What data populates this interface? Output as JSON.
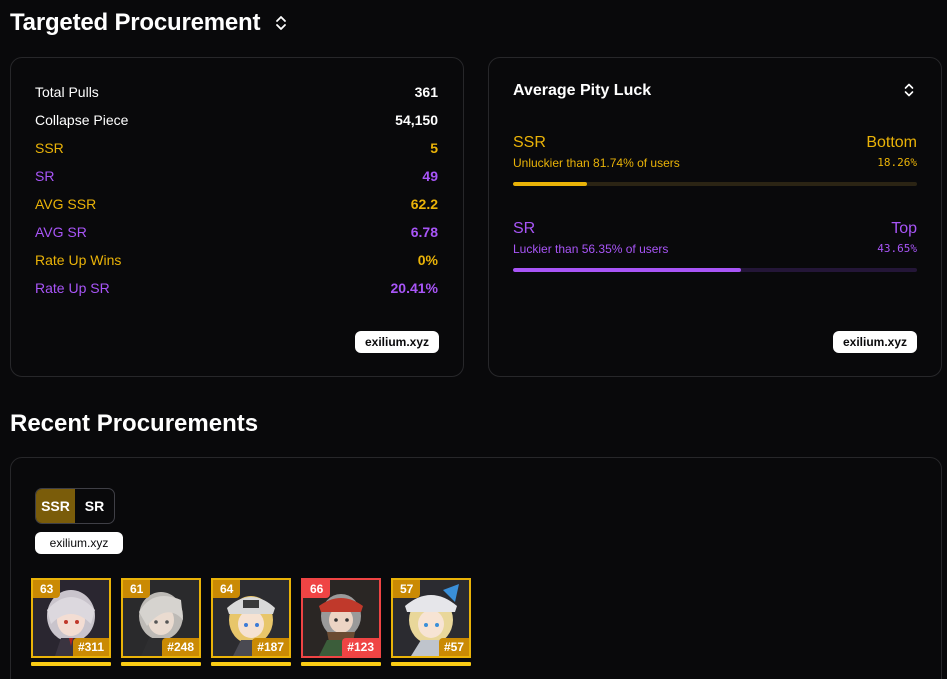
{
  "header": {
    "title": "Targeted Procurement"
  },
  "stats": {
    "rows": [
      {
        "label": "Total Pulls",
        "value": "361",
        "color": "white"
      },
      {
        "label": "Collapse Piece",
        "value": "54,150",
        "color": "white"
      },
      {
        "label": "SSR",
        "value": "5",
        "color": "gold"
      },
      {
        "label": "SR",
        "value": "49",
        "color": "purple"
      },
      {
        "label": "AVG SSR",
        "value": "62.2",
        "color": "gold"
      },
      {
        "label": "AVG SR",
        "value": "6.78",
        "color": "purple"
      },
      {
        "label": "Rate Up Wins",
        "value": "0%",
        "color": "gold"
      },
      {
        "label": "Rate Up SR",
        "value": "20.41%",
        "color": "purple"
      }
    ],
    "watermark": "exilium.xyz"
  },
  "pity": {
    "title": "Average Pity Luck",
    "ssr": {
      "label": "SSR",
      "rank": "Bottom",
      "desc": "Unluckier than 81.74% of users",
      "pct": "18.26%",
      "fill": 0.1826
    },
    "sr": {
      "label": "SR",
      "rank": "Top",
      "desc": "Luckier than 56.35% of users",
      "pct": "43.65%",
      "fill": 0.5635
    },
    "watermark": "exilium.xyz"
  },
  "recent": {
    "title": "Recent Procurements",
    "tabs": [
      "SSR",
      "SR"
    ],
    "active_tab": "SSR",
    "watermark": "exilium.xyz",
    "items": [
      {
        "pity": "63",
        "num": "#311",
        "border": "gold"
      },
      {
        "pity": "61",
        "num": "#248",
        "border": "gold"
      },
      {
        "pity": "64",
        "num": "#187",
        "border": "gold"
      },
      {
        "pity": "66",
        "num": "#123",
        "border": "red"
      },
      {
        "pity": "57",
        "num": "#57",
        "border": "gold"
      }
    ]
  },
  "colors": {
    "gold": "#eab308",
    "purple": "#a855f7",
    "red": "#ef4444",
    "bg": "#09090b"
  }
}
